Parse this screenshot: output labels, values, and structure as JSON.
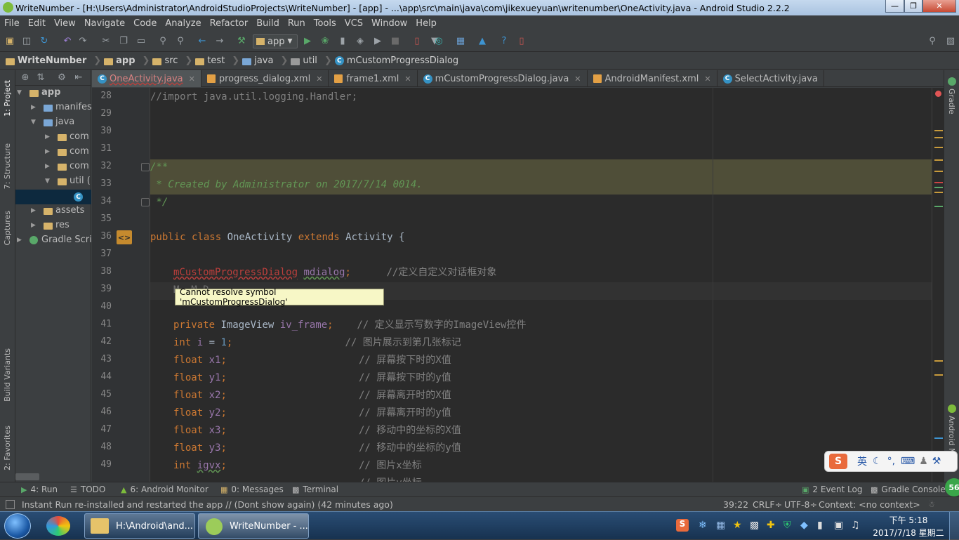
{
  "window": {
    "title": "WriteNumber - [H:\\Users\\Administrator\\AndroidStudioProjects\\WriteNumber] - [app] - ...\\app\\src\\main\\java\\com\\jikexueyuan\\writenumber\\OneActivity.java - Android Studio 2.2.2"
  },
  "menu": [
    "File",
    "Edit",
    "View",
    "Navigate",
    "Code",
    "Analyze",
    "Refactor",
    "Build",
    "Run",
    "Tools",
    "VCS",
    "Window",
    "Help"
  ],
  "toolbar": {
    "run_config": "app"
  },
  "breadcrumb": [
    "WriteNumber",
    "app",
    "src",
    "test",
    "java",
    "util",
    "mCustomProgressDialog"
  ],
  "left_tools": {
    "project": "1: Project",
    "structure": "7: Structure",
    "captures": "Captures",
    "build_variants": "Build Variants",
    "favorites": "2: Favorites"
  },
  "right_tools": {
    "gradle": "Gradle",
    "android_model": "Android M"
  },
  "tree": [
    {
      "label": "app",
      "level": 0,
      "expanded": true
    },
    {
      "label": "manifests",
      "level": 1,
      "expanded": false
    },
    {
      "label": "java",
      "level": 1,
      "expanded": true
    },
    {
      "label": "com",
      "level": 2,
      "expanded": false
    },
    {
      "label": "com",
      "level": 2,
      "expanded": false
    },
    {
      "label": "com",
      "level": 2,
      "expanded": false
    },
    {
      "label": "util (",
      "level": 2,
      "expanded": true
    },
    {
      "label": "",
      "level": 3,
      "selected": true
    },
    {
      "label": "assets",
      "level": 1,
      "expanded": false
    },
    {
      "label": "res",
      "level": 1,
      "expanded": false
    },
    {
      "label": "Gradle Scripts",
      "level": 0,
      "expanded": false
    }
  ],
  "tabs": [
    {
      "label": "OneActivity.java",
      "type": "java",
      "active": true
    },
    {
      "label": "progress_dialog.xml",
      "type": "xml"
    },
    {
      "label": "frame1.xml",
      "type": "xml"
    },
    {
      "label": "mCustomProgressDialog.java",
      "type": "java"
    },
    {
      "label": "AndroidManifest.xml",
      "type": "xml"
    },
    {
      "label": "SelectActivity.java",
      "type": "java"
    }
  ],
  "code": {
    "line_numbers": [
      "28",
      "29",
      "30",
      "31",
      "32",
      "33",
      "34",
      "35",
      "36",
      "37",
      "38",
      "39",
      "40",
      "41",
      "42",
      "43",
      "44",
      "45",
      "46",
      "47",
      "48",
      "49"
    ],
    "l28": "//import java.util.logging.Handler;",
    "l32": "/**",
    "l33": " * Created by Administrator on 2017/7/14 0014.",
    "l34": " */",
    "l36_kw1": "public class ",
    "l36_name": "OneActivity ",
    "l36_kw2": "extends ",
    "l36_rest": "Activity {",
    "l38_type": "mCustomProgressDialog",
    "l38_field": "mdialog",
    "l38_semi": ";",
    "l38_comment": "//定义自定义对话框对象",
    "l39_partial": "M  M D",
    "l41_kw": "private ",
    "l41_type": "ImageView ",
    "l41_field": "iv_frame",
    "l41_semi": ";",
    "l41_comment": "// 定义显示写数字的ImageView控件",
    "l42_kw": "int ",
    "l42_field": "i",
    "l42_eq": " = ",
    "l42_num": "1",
    "l42_semi": ";",
    "l42_comment": "// 图片展示到第几张标记",
    "floats": [
      {
        "kw": "float ",
        "name": "x1",
        "comment": "// 屏幕按下时的X值"
      },
      {
        "kw": "float ",
        "name": "y1",
        "comment": "// 屏幕按下时的y值"
      },
      {
        "kw": "float ",
        "name": "x2",
        "comment": "// 屏幕离开时的X值"
      },
      {
        "kw": "float ",
        "name": "y2",
        "comment": "// 屏幕离开时的y值"
      },
      {
        "kw": "float ",
        "name": "x3",
        "comment": "// 移动中的坐标的X值"
      },
      {
        "kw": "float ",
        "name": "y3",
        "comment": "// 移动中的坐标的y值"
      },
      {
        "kw": "int ",
        "name": "igvx",
        "comment": "// 图片x坐标"
      }
    ],
    "l50_comment": "// 图片y坐标"
  },
  "tooltip": "Cannot resolve symbol 'mCustomProgressDialog'",
  "bottom_tools": {
    "run": "4: Run",
    "todo": "TODO",
    "monitor": "6: Android Monitor",
    "messages": "0: Messages",
    "terminal": "Terminal",
    "event_log": "2 Event Log",
    "gradle_console": "Gradle Console"
  },
  "status": {
    "message": "Instant Run re-installed and restarted the app // (Dont show again) (42 minutes ago)",
    "position": "39:22",
    "line_sep": "CRLF÷",
    "encoding": "UTF-8÷",
    "context": "Context: <no context>",
    "badge": "56"
  },
  "taskbar": {
    "task1": "H:\\Android\\and...",
    "task2": "WriteNumber - ...",
    "time": "下午 5:18",
    "date": "2017/7/18 星期二"
  },
  "ime": {
    "lang": "英"
  },
  "colors": {
    "editor_bg": "#2b2b2b",
    "keyword": "#cc7832",
    "field": "#9876aa",
    "comment": "#808080",
    "doc_comment": "#629755",
    "error": "#bc3f3c"
  }
}
